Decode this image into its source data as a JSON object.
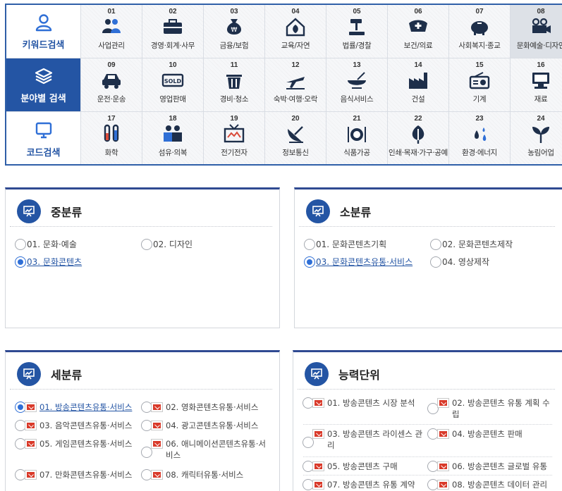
{
  "tabs": [
    {
      "label": "키워드검색",
      "icon": "person-icon"
    },
    {
      "label": "분야별 검색",
      "icon": "layers-icon"
    },
    {
      "label": "코드검색",
      "icon": "monitor-icon"
    }
  ],
  "categories": [
    {
      "num": "01",
      "label": "사업관리",
      "icon": "people-icon"
    },
    {
      "num": "02",
      "label": "경영·회계·사무",
      "icon": "briefcase-icon"
    },
    {
      "num": "03",
      "label": "금융/보험",
      "icon": "money-bag-icon"
    },
    {
      "num": "04",
      "label": "교육/자연",
      "icon": "home-leaf-icon"
    },
    {
      "num": "05",
      "label": "법률/경찰",
      "icon": "gavel-icon"
    },
    {
      "num": "06",
      "label": "보건/의료",
      "icon": "nurse-cap-icon"
    },
    {
      "num": "07",
      "label": "사회복지·종교",
      "icon": "piggy-bank-icon"
    },
    {
      "num": "08",
      "label": "문화예술·디자인",
      "icon": "film-camera-icon"
    },
    {
      "num": "09",
      "label": "운전·운송",
      "icon": "car-icon"
    },
    {
      "num": "10",
      "label": "영업판매",
      "icon": "sold-sign-icon",
      "icon_text": "SOLD"
    },
    {
      "num": "11",
      "label": "경비·청소",
      "icon": "trash-bin-icon"
    },
    {
      "num": "12",
      "label": "숙박·여행·오락",
      "icon": "airplane-icon"
    },
    {
      "num": "13",
      "label": "음식서비스",
      "icon": "bowl-icon"
    },
    {
      "num": "14",
      "label": "건설",
      "icon": "factory-icon"
    },
    {
      "num": "15",
      "label": "기계",
      "icon": "radio-icon"
    },
    {
      "num": "16",
      "label": "재료",
      "icon": "computer-icon"
    },
    {
      "num": "17",
      "label": "화학",
      "icon": "test-tube-icon"
    },
    {
      "num": "18",
      "label": "섬유·의복",
      "icon": "workers-icon"
    },
    {
      "num": "19",
      "label": "전기전자",
      "icon": "tv-icon"
    },
    {
      "num": "20",
      "label": "정보통신",
      "icon": "satellite-dish-icon"
    },
    {
      "num": "21",
      "label": "식품가공",
      "icon": "plate-cutlery-icon"
    },
    {
      "num": "22",
      "label": "인쇄·목재·가구·공예",
      "icon": "leaf-icon"
    },
    {
      "num": "23",
      "label": "환경·에너지",
      "icon": "drops-icon"
    },
    {
      "num": "24",
      "label": "농림어업",
      "icon": "sprout-icon"
    }
  ],
  "boxes": {
    "middle": {
      "title": "중분류",
      "options": [
        {
          "label": "01. 문화·예술",
          "selected": false
        },
        {
          "label": "02. 디자인",
          "selected": false
        },
        {
          "label": "03. 문화콘텐츠",
          "selected": true
        }
      ]
    },
    "small": {
      "title": "소분류",
      "options": [
        {
          "label": "01. 문화콘텐츠기획",
          "selected": false
        },
        {
          "label": "02. 문화콘텐츠제작",
          "selected": false
        },
        {
          "label": "03. 문화콘텐츠유통·서비스",
          "selected": true
        },
        {
          "label": "04. 영상제작",
          "selected": false
        }
      ]
    },
    "detail": {
      "title": "세분류",
      "options": [
        {
          "label": "01. 방송콘텐츠유통·서비스",
          "selected": true
        },
        {
          "label": "02. 영화콘텐츠유통·서비스",
          "selected": false
        },
        {
          "label": "03. 음악콘텐츠유통·서비스",
          "selected": false
        },
        {
          "label": "04. 광고콘텐츠유통·서비스",
          "selected": false
        },
        {
          "label": "05. 게임콘텐츠유통·서비스",
          "selected": false
        },
        {
          "label": "06. 애니메이션콘텐츠유통·서비스",
          "selected": false
        },
        {
          "label": "07. 만화콘텐츠유통·서비스",
          "selected": false
        },
        {
          "label": "08. 캐릭터유통·서비스",
          "selected": false
        }
      ]
    },
    "units": {
      "title": "능력단위",
      "options": [
        {
          "label": "01. 방송콘텐츠 시장 분석",
          "selected": false
        },
        {
          "label": "02. 방송콘텐츠 유통 계획 수립",
          "selected": false
        },
        {
          "label": "03. 방송콘텐츠 라이센스 관리",
          "selected": false
        },
        {
          "label": "04. 방송콘텐츠 판매",
          "selected": false
        },
        {
          "label": "05. 방송콘텐츠 구매",
          "selected": false
        },
        {
          "label": "06. 방송콘텐츠 글로벌 유통",
          "selected": false
        },
        {
          "label": "07. 방송콘텐츠 유통 계약",
          "selected": false
        },
        {
          "label": "08. 방송콘텐츠 데이터 관리",
          "selected": false
        }
      ]
    }
  },
  "colors": {
    "accent": "#2455a4",
    "border": "#2f5fa8",
    "selected_radio": "#2f6fd6",
    "badge_red": "#d93a2a"
  }
}
